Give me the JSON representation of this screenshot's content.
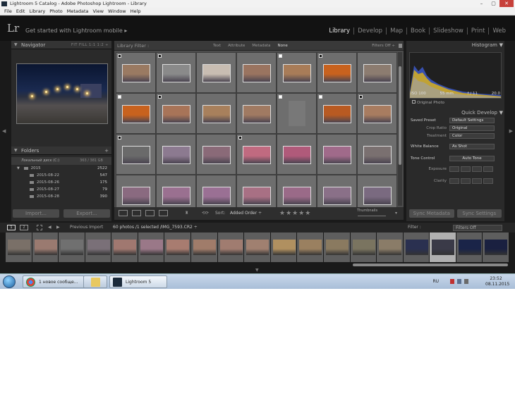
{
  "window": {
    "title": "Lightroom 5 Catalog - Adobe Photoshop Lightroom - Library",
    "controls": [
      "–",
      "▢",
      "✕"
    ]
  },
  "menubar": [
    "File",
    "Edit",
    "Library",
    "Photo",
    "Metadata",
    "View",
    "Window",
    "Help"
  ],
  "identity": {
    "logo": "Lr",
    "get_started": "Get started with Lightroom mobile ▸"
  },
  "modules": [
    {
      "label": "Library",
      "active": true
    },
    {
      "label": "Develop",
      "active": false
    },
    {
      "label": "Map",
      "active": false
    },
    {
      "label": "Book",
      "active": false
    },
    {
      "label": "Slideshow",
      "active": false
    },
    {
      "label": "Print",
      "active": false
    },
    {
      "label": "Web",
      "active": false
    }
  ],
  "navigator": {
    "title": "Navigator",
    "options": "FIT  FILL  1:1  1:2 ÷"
  },
  "folders": {
    "title": "Folders",
    "add": "+",
    "disk": {
      "name": "Локальный диск (C:)",
      "size": "363 / 381 GB"
    },
    "items": [
      {
        "name": "2015",
        "count": "2522"
      },
      {
        "name": "2015-08-22",
        "count": "547"
      },
      {
        "name": "2015-08-26",
        "count": "175"
      },
      {
        "name": "2015-08-27",
        "count": "79"
      },
      {
        "name": "2015-08-28",
        "count": "390"
      }
    ]
  },
  "left_buttons": {
    "import": "Import...",
    "export": "Export..."
  },
  "library_filter": {
    "label": "Library Filter :",
    "options": [
      "Text",
      "Attribute",
      "Metadata",
      "None"
    ],
    "selected": "None",
    "filters_off": "Filters Off ÷"
  },
  "grid": {
    "cells": [
      {
        "color": "#9a7a62",
        "mark": "b",
        "port": false
      },
      {
        "color": "#8a8a8a",
        "mark": "b",
        "port": false
      },
      {
        "color": "#c8bdb2",
        "mark": "",
        "port": false
      },
      {
        "color": "#9a7460",
        "mark": "",
        "port": false
      },
      {
        "color": "#a87c58",
        "mark": "w",
        "port": false
      },
      {
        "color": "#c8621e",
        "mark": "b",
        "port": false
      },
      {
        "color": "#8c7c70",
        "mark": "",
        "port": false
      },
      {
        "color": "#c8621e",
        "mark": "w",
        "port": false
      },
      {
        "color": "#a87458",
        "mark": "b",
        "port": false
      },
      {
        "color": "#a8805c",
        "mark": "",
        "port": false
      },
      {
        "color": "#a07a62",
        "mark": "",
        "port": false
      },
      {
        "color": "#787878",
        "mark": "w",
        "port": true
      },
      {
        "color": "#b85a22",
        "mark": "w",
        "port": false
      },
      {
        "color": "#a87c60",
        "mark": "b",
        "port": false
      },
      {
        "color": "#6a6a6a",
        "mark": "b",
        "port": false
      },
      {
        "color": "#8c7a90",
        "mark": "",
        "port": false
      },
      {
        "color": "#8a6a78",
        "mark": "",
        "port": false
      },
      {
        "color": "#c06a80",
        "mark": "b",
        "port": false
      },
      {
        "color": "#b05a7a",
        "mark": "",
        "port": false
      },
      {
        "color": "#a06a8a",
        "mark": "",
        "port": false
      },
      {
        "color": "#7a7070",
        "mark": "",
        "port": false
      },
      {
        "color": "#8a6a80",
        "mark": "",
        "port": false
      },
      {
        "color": "#9a7090",
        "mark": "",
        "port": false
      },
      {
        "color": "#9a7094",
        "mark": "",
        "port": false
      },
      {
        "color": "#a87084",
        "mark": "",
        "port": false
      },
      {
        "color": "#9a6a88",
        "mark": "",
        "port": false
      },
      {
        "color": "#8a7088",
        "mark": "",
        "port": false
      },
      {
        "color": "#7a6a80",
        "mark": "",
        "port": false
      }
    ]
  },
  "toolbar": {
    "sort_label": "Sort:",
    "sort_value": "Added Order ÷",
    "stars": "★★★★★",
    "thumbnails": "Thumbnails"
  },
  "histogram": {
    "title": "Histogram",
    "iso": "ISO 100",
    "focal": "55 mm",
    "aperture": "f / 11",
    "shutter": "20.0",
    "original": "Original Photo"
  },
  "quick_develop": {
    "title": "Quick Develop",
    "saved_preset": {
      "label": "Saved Preset",
      "value": "Default Settings"
    },
    "crop_ratio": {
      "label": "Crop Ratio",
      "value": "Original"
    },
    "treatment": {
      "label": "Treatment",
      "value": "Color"
    },
    "white_balance": {
      "label": "White Balance",
      "value": "As Shot"
    },
    "tone_control": {
      "label": "Tone Control",
      "value": "Auto Tone"
    },
    "exposure": "Exposure",
    "clarity": "Clarity"
  },
  "sync": {
    "metadata": "Sync Metadata",
    "settings": "Sync Settings"
  },
  "filmstrip_bar": {
    "page1": "1",
    "page2": "2",
    "source": "Previous Import",
    "count": "60 photos /1 selected /IMG_7593.CR2 ÷",
    "filter_label": "Filter :",
    "filter_value": "Filters Off"
  },
  "filmstrip": [
    {
      "color": "#7a7068"
    },
    {
      "color": "#9a7a70"
    },
    {
      "color": "#707070"
    },
    {
      "color": "#7a7078"
    },
    {
      "color": "#a07870"
    },
    {
      "color": "#9a7888"
    },
    {
      "color": "#a87c70"
    },
    {
      "color": "#a07c6a"
    },
    {
      "color": "#a07c70"
    },
    {
      "color": "#a08070"
    },
    {
      "color": "#b09060"
    },
    {
      "color": "#9a8060"
    },
    {
      "color": "#8a7a60"
    },
    {
      "color": "#7a7460"
    },
    {
      "color": "#8a7c68"
    },
    {
      "color": "#2a3050"
    },
    {
      "color": "#3a3a48",
      "selected": true
    },
    {
      "color": "#1a2448"
    },
    {
      "color": "#1a2040"
    }
  ],
  "taskbar": {
    "chrome": "1 новое сообще...",
    "lightroom": "Lightroom 5 Catalog",
    "lang": "RU",
    "time": "23:52",
    "date": "08.11.2015"
  }
}
